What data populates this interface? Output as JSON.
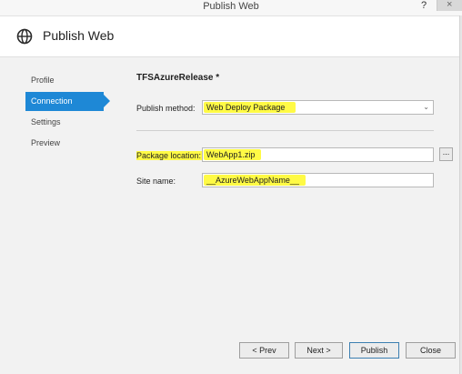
{
  "window": {
    "title": "Publish Web",
    "help": "?",
    "close": "×"
  },
  "header": {
    "title": "Publish Web",
    "icon": "globe-icon"
  },
  "nav": {
    "items": [
      {
        "label": "Profile",
        "active": false
      },
      {
        "label": "Connection",
        "active": true
      },
      {
        "label": "Settings",
        "active": false
      },
      {
        "label": "Preview",
        "active": false
      }
    ]
  },
  "connection": {
    "profile_name": "TFSAzureRelease *",
    "publish_method_label": "Publish method:",
    "publish_method_value": "Web Deploy Package",
    "package_location_label": "Package location:",
    "package_location_value": "WebApp1.zip",
    "browse_label": "...",
    "site_name_label": "Site name:",
    "site_name_value": "__AzureWebAppName__"
  },
  "buttons": {
    "prev": "< Prev",
    "next": "Next >",
    "publish": "Publish",
    "close": "Close"
  },
  "colors": {
    "accent": "#1e88d6",
    "highlight": "#fffa45"
  }
}
